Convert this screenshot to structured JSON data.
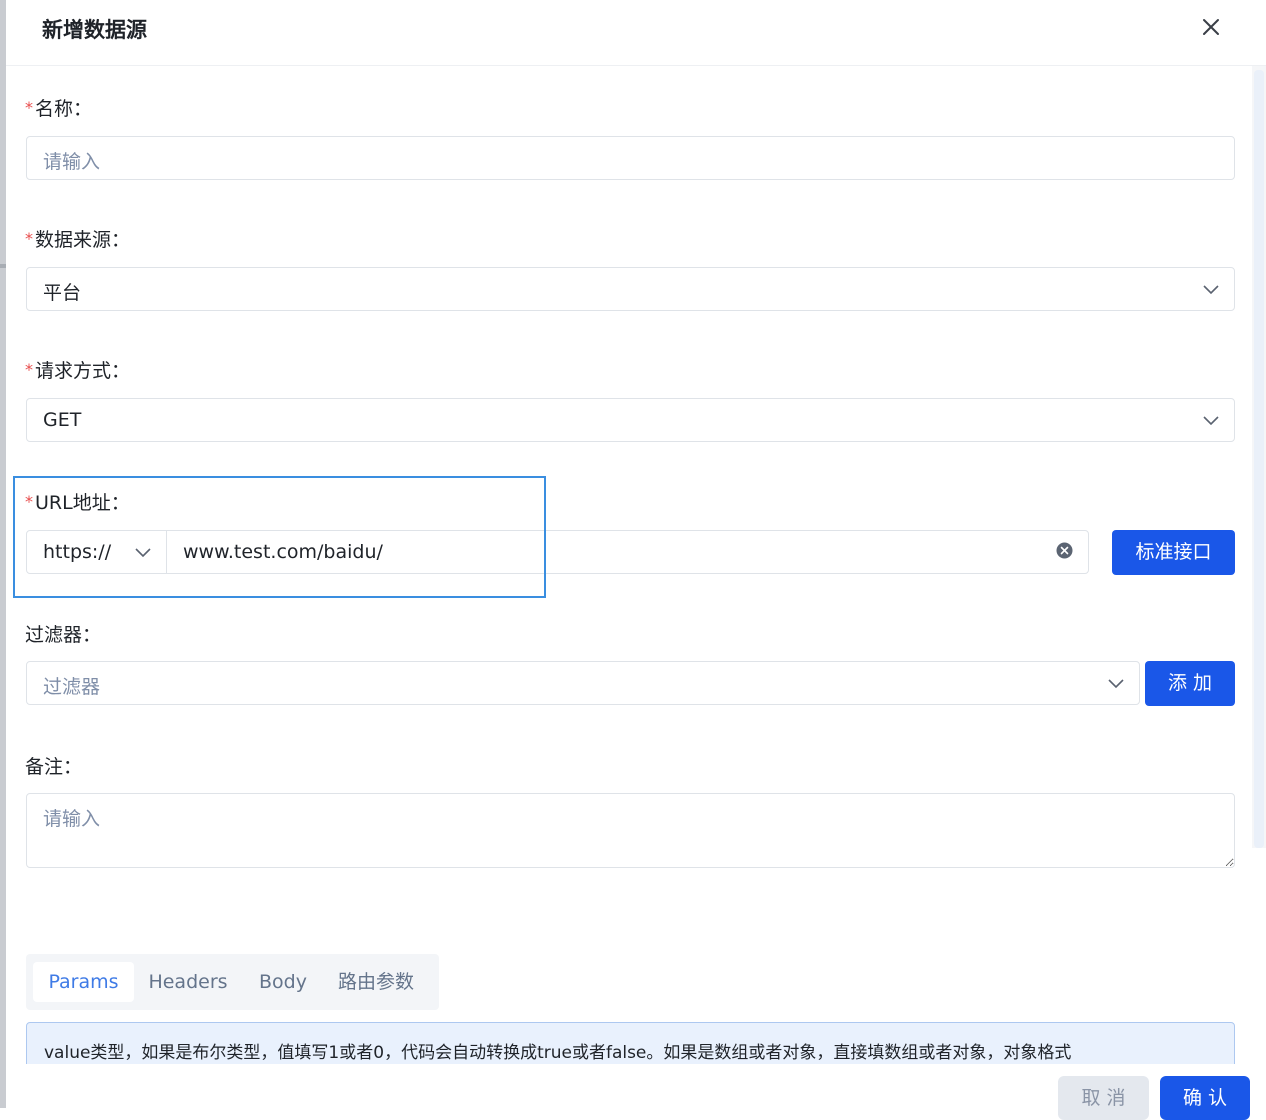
{
  "dialog": {
    "title": "新增数据源"
  },
  "form": {
    "name": {
      "required_mark": "*",
      "label": "名称：",
      "placeholder": "请输入"
    },
    "data_source": {
      "required_mark": "*",
      "label": "数据来源：",
      "value": "平台"
    },
    "method": {
      "required_mark": "*",
      "label": "请求方式：",
      "value": "GET"
    },
    "url": {
      "required_mark": "*",
      "label": "URL地址：",
      "protocol": "https://",
      "value": "www.test.com/baidu/",
      "standard_button": "标准接口"
    },
    "filter": {
      "label": "过滤器：",
      "placeholder": "过滤器",
      "add_button": "添 加"
    },
    "remark": {
      "label": "备注：",
      "placeholder": "请输入"
    }
  },
  "tabs": [
    {
      "label": "Params",
      "active": true
    },
    {
      "label": "Headers",
      "active": false
    },
    {
      "label": "Body",
      "active": false
    },
    {
      "label": "路由参数",
      "active": false
    }
  ],
  "info": {
    "text": "value类型，如果是布尔类型，值填写1或者0，代码会自动转换成true或者false。如果是数组或者对象，直接填数组或者对象，对象格式"
  },
  "footer": {
    "cancel_label": "取 消",
    "confirm_label": "确 认"
  },
  "colors": {
    "primary": "#1a57e8",
    "required": "#e84c4c",
    "highlight_border": "#3a8ee0",
    "tab_active": "#3f7be6",
    "info_bg": "#e9f1fd"
  }
}
